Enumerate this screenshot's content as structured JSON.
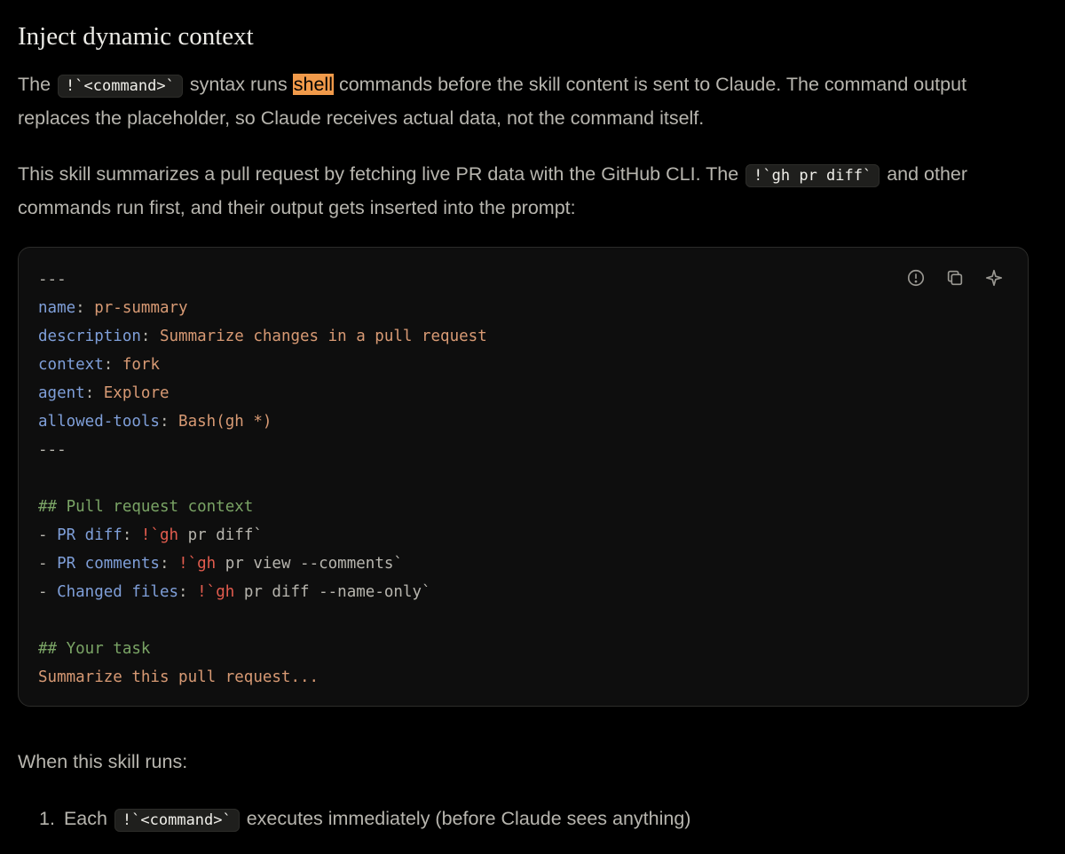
{
  "heading": "Inject dynamic context",
  "para1": {
    "t1": "The ",
    "code": "!`<command>`",
    "t2": " syntax runs ",
    "highlight": "shell",
    "t3": " commands before the skill content is sent to Claude. The command output replaces the placeholder, so Claude receives actual data, not the command itself."
  },
  "para2": {
    "t1": "This skill summarizes a pull request by fetching live PR data with the GitHub CLI. The ",
    "code": "!`gh pr diff`",
    "t2": " and other commands run first, and their output gets inserted into the prompt:"
  },
  "code_block": {
    "toolbar": {
      "info_icon": "info-circle-icon",
      "copy_icon": "copy-icon",
      "sparkle_icon": "sparkle-icon"
    },
    "fm_open": "---",
    "l_name_key": "name",
    "l_name_val": "pr-summary",
    "l_desc_key": "description",
    "l_desc_val": "Summarize changes in a pull request",
    "l_ctx_key": "context",
    "l_ctx_val": "fork",
    "l_agent_key": "agent",
    "l_agent_val": "Explore",
    "l_tools_key": "allowed-tools",
    "l_tools_val": "Bash(gh *)",
    "fm_close": "---",
    "section1": "## Pull request context",
    "b1_label": "PR diff",
    "b1_cmd": "!`gh",
    "b1_rest": " pr diff`",
    "b2_label": "PR comments",
    "b2_cmd": "!`gh",
    "b2_rest": " pr view --comments`",
    "b3_label": "Changed files",
    "b3_cmd": "!`gh",
    "b3_rest": " pr diff --name-only`",
    "section2": "## Your task",
    "task": "Summarize this pull request..."
  },
  "para3": "When this skill runs:",
  "list": {
    "num": "1.",
    "t1": "Each ",
    "code": "!`<command>`",
    "t2": " executes immediately (before Claude sees anything)"
  },
  "colors": {
    "key": "#7f9fd9",
    "value": "#d89a74",
    "comment": "#7aa465",
    "command": "#e25c4e",
    "highlight": "#f19a4a"
  }
}
